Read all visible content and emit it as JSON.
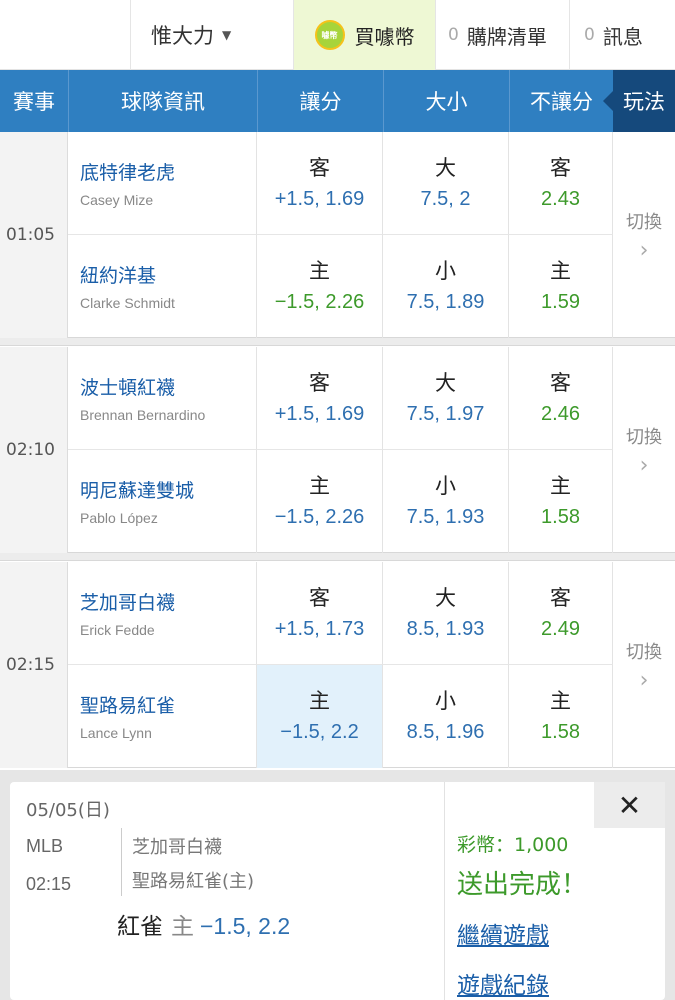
{
  "header": {
    "username": "惟大力",
    "buy_coins": "買噱幣",
    "coin_logo_text": "噱幣",
    "cart": {
      "count": "0",
      "label": "購牌清單"
    },
    "messages": {
      "count": "0",
      "label": "訊息"
    }
  },
  "table_header": {
    "event": "賽事",
    "team_info": "球隊資訊",
    "spread": "讓分",
    "total": "大小",
    "moneyline": "不讓分",
    "play": "玩法"
  },
  "switch_label": "切換",
  "games": [
    {
      "time": "01:05",
      "away": {
        "team": "底特律老虎",
        "pitcher": "Casey Mize",
        "spread_label": "客",
        "spread_odds": "+1.5, 1.69",
        "total_label": "大",
        "total_odds": "7.5, 2",
        "ml_label": "客",
        "ml_odds": "2.43"
      },
      "home": {
        "team": "紐約洋基",
        "pitcher": "Clarke Schmidt",
        "spread_label": "主",
        "spread_odds": "−1.5, 2.26",
        "total_label": "小",
        "total_odds": "7.5, 1.89",
        "ml_label": "主",
        "ml_odds": "1.59"
      }
    },
    {
      "time": "02:10",
      "away": {
        "team": "波士頓紅襪",
        "pitcher": "Brennan Bernardino",
        "spread_label": "客",
        "spread_odds": "+1.5, 1.69",
        "total_label": "大",
        "total_odds": "7.5, 1.97",
        "ml_label": "客",
        "ml_odds": "2.46"
      },
      "home": {
        "team": "明尼蘇達雙城",
        "pitcher": "Pablo López",
        "spread_label": "主",
        "spread_odds": "−1.5, 2.26",
        "total_label": "小",
        "total_odds": "7.5, 1.93",
        "ml_label": "主",
        "ml_odds": "1.58"
      }
    },
    {
      "time": "02:15",
      "away": {
        "team": "芝加哥白襪",
        "pitcher": "Erick Fedde",
        "spread_label": "客",
        "spread_odds": "+1.5, 1.73",
        "total_label": "大",
        "total_odds": "8.5, 1.93",
        "ml_label": "客",
        "ml_odds": "2.49"
      },
      "home": {
        "team": "聖路易紅雀",
        "pitcher": "Lance Lynn",
        "spread_label": "主",
        "spread_odds": "−1.5, 2.2",
        "total_label": "小",
        "total_odds": "8.5, 1.96",
        "ml_label": "主",
        "ml_odds": "1.58"
      }
    }
  ],
  "confirmation": {
    "date": "05/05(日)",
    "league": "MLB",
    "time": "02:15",
    "away_team": "芝加哥白襪",
    "home_team": "聖路易紅雀(主)",
    "pick_team": "紅雀",
    "pick_side": "主",
    "pick_odds": "−1.5, 2.2",
    "coins": "彩幣：1,000",
    "status": "送出完成！",
    "continue_link": "繼續遊戲",
    "history_link": "遊戲紀錄",
    "close_symbol": "✕"
  },
  "colors": {
    "header_blue": "#2f7fc1",
    "play_dark_blue": "#15497c",
    "odds_blue": "#2e6fb0",
    "odds_green": "#3d9a2b",
    "team_link": "#1a5ea8",
    "selected_bg": "#e2f1fb"
  },
  "icons": [
    "coin-logo-icon",
    "caret-down-icon",
    "chevron-right-icon",
    "close-icon"
  ]
}
